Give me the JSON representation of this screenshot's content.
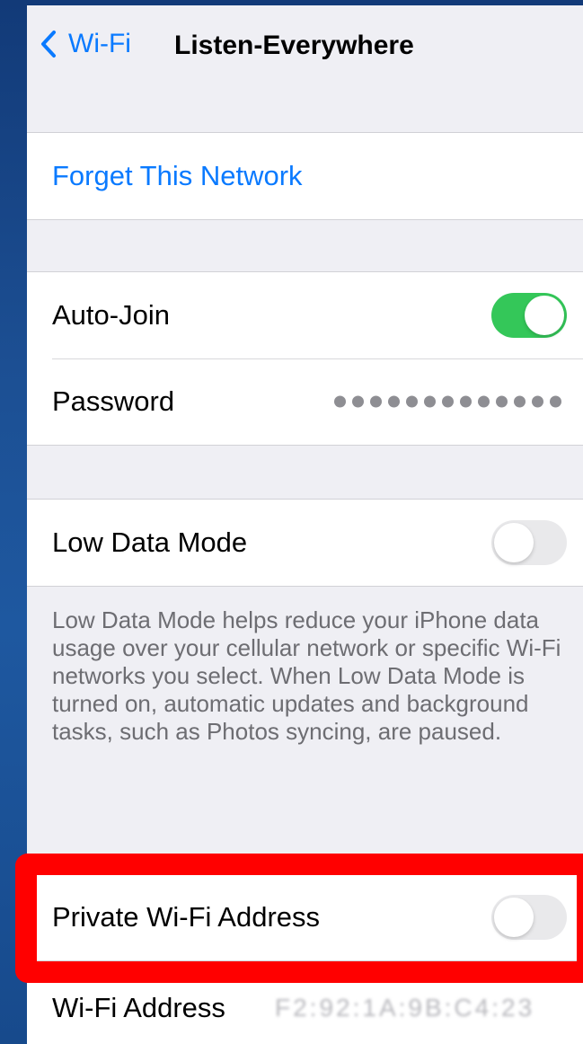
{
  "nav": {
    "back_label": "Wi-Fi",
    "title": "Listen-Everywhere"
  },
  "forget": {
    "label": "Forget This Network"
  },
  "auto_join": {
    "label": "Auto-Join",
    "enabled": true
  },
  "password": {
    "label": "Password",
    "masked_value": "●●●●●●●●●●●●●"
  },
  "low_data_mode": {
    "label": "Low Data Mode",
    "enabled": false,
    "footer": "Low Data Mode helps reduce your iPhone data usage over your cellular network or specific Wi-Fi networks you select. When Low Data Mode is turned on, automatic updates and background tasks, such as Photos syncing, are paused."
  },
  "private_address": {
    "label": "Private Wi-Fi Address",
    "enabled": false
  },
  "wifi_address": {
    "label": "Wi-Fi Address",
    "value": "F2:92:1A:9B:C4:23"
  },
  "colors": {
    "accent": "#0a7aff",
    "toggle_on": "#34c759",
    "highlight": "#ff0000"
  }
}
